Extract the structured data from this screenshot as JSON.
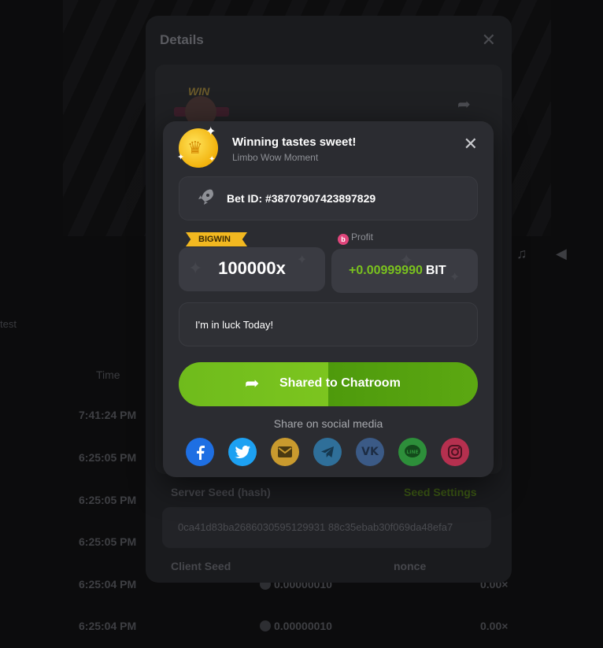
{
  "background": {
    "side_text": "test",
    "time_header": "Time",
    "rows": [
      {
        "time": "7:41:24 PM",
        "amount": "",
        "mult": ""
      },
      {
        "time": "6:25:05 PM",
        "amount": "",
        "mult": ""
      },
      {
        "time": "6:25:05 PM",
        "amount": "",
        "mult": ""
      },
      {
        "time": "6:25:05 PM",
        "amount": "",
        "mult": ""
      },
      {
        "time": "6:25:04 PM",
        "amount": "0.00000010",
        "mult": "0.00×"
      },
      {
        "time": "6:25:04 PM",
        "amount": "0.00000010",
        "mult": "0.00×"
      }
    ]
  },
  "details": {
    "title": "Details",
    "close_icon": "close-icon",
    "badge_text": "WIN",
    "server_seed_label": "Server Seed (hash)",
    "seed_settings": "Seed Settings",
    "server_seed_hash": "0ca41d83ba2686030595129931 88c35ebab30f069da48efa7",
    "client_seed_label": "Client Seed",
    "nonce_label": "nonce"
  },
  "modal": {
    "title": "Winning tastes sweet!",
    "subtitle": "Limbo Wow Moment",
    "bet_id": "Bet ID: #38707907423897829",
    "bigwin_label": "BIGWIN",
    "multiplier": "100000x",
    "profit_label": "Profit",
    "profit_value": "+0.00999990",
    "profit_currency": "BIT",
    "message": "I'm in luck Today!",
    "share_button": "Shared to Chatroom",
    "social_title": "Share on social media",
    "socials": [
      {
        "name": "facebook",
        "color": "#1e6fe3"
      },
      {
        "name": "twitter",
        "color": "#1da1f2"
      },
      {
        "name": "email",
        "color": "#c99a2e"
      },
      {
        "name": "telegram",
        "color": "#2f6f99"
      },
      {
        "name": "vk",
        "color": "#3b5a86"
      },
      {
        "name": "line",
        "color": "#2d8f3a"
      },
      {
        "name": "instagram",
        "color": "#b5304f"
      }
    ]
  }
}
